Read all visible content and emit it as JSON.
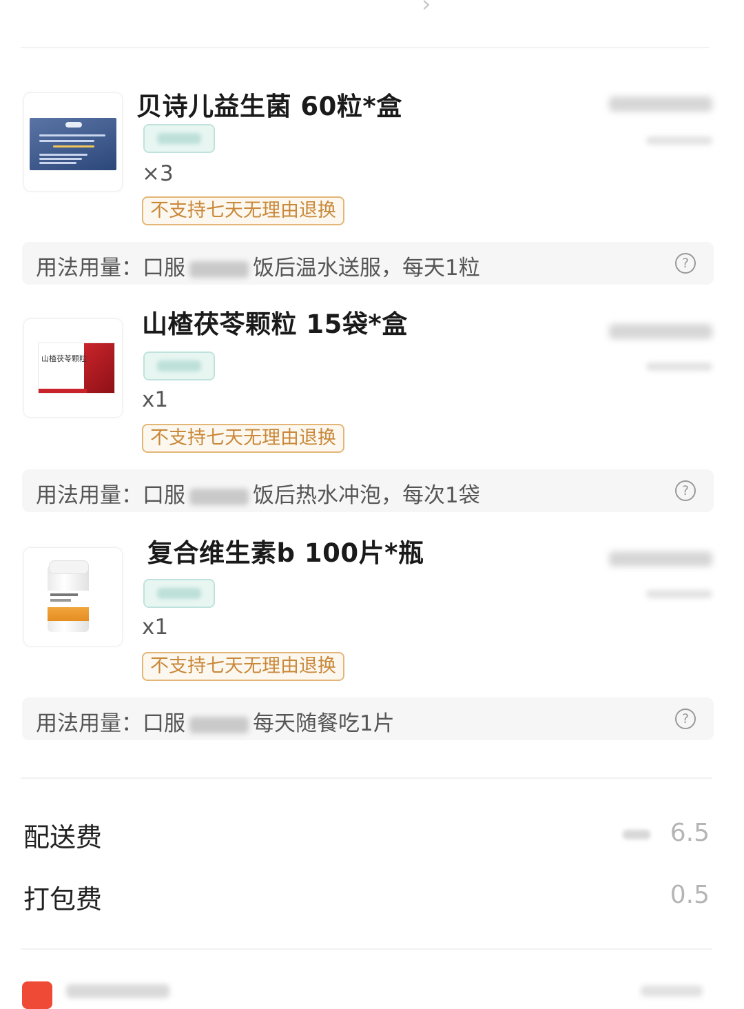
{
  "items": [
    {
      "name": "贝诗儿益生菌 60粒*盒",
      "qty": "×3",
      "return_policy": "不支持七天无理由退换",
      "usage_prefix": "用法用量：口服",
      "usage_suffix": "饭后温水送服，每天1粒",
      "help_icon": "question-circle-icon"
    },
    {
      "name": "山楂茯苓颗粒 15袋*盒",
      "qty": "x1",
      "return_policy": "不支持七天无理由退换",
      "usage_prefix": "用法用量：口服",
      "usage_suffix": "饭后热水冲泡，每次1袋",
      "help_icon": "question-circle-icon"
    },
    {
      "name": "复合维生素b 100片*瓶",
      "qty": "x1",
      "return_policy": "不支持七天无理由退换",
      "usage_prefix": "用法用量：口服",
      "usage_suffix": "每天随餐吃1片",
      "help_icon": "question-circle-icon"
    }
  ],
  "fees": {
    "delivery_label": "配送费",
    "delivery_value": "6.5",
    "packing_label": "打包费",
    "packing_value": "0.5"
  },
  "colors": {
    "return_tag": "#c9883a",
    "tag_bg": "#e8f6f2",
    "usage_bg": "#f6f6f6",
    "bottom_icon": "#ef4a35"
  }
}
